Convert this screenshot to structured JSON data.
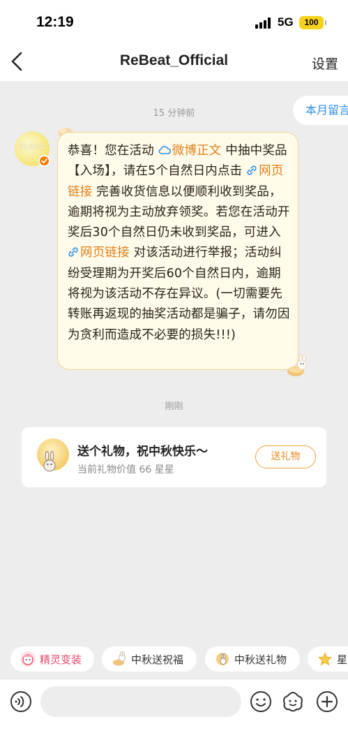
{
  "status": {
    "time": "12:19",
    "network": "5G",
    "battery": "100"
  },
  "nav": {
    "title": "ReBeat_Official",
    "settings": "设置"
  },
  "side_pill": {
    "label": "本月留言"
  },
  "avatar": {
    "text": "ReBeat"
  },
  "messages": [
    {
      "time": "15 分钟前",
      "segments": [
        {
          "text": "恭喜！您在活动 ",
          "link": false
        },
        {
          "text": "微博正文",
          "link": true,
          "icon": "cloud-icon"
        },
        {
          "text": " 中抽中奖品【入场】，请在5个自然日内点击 ",
          "link": false
        },
        {
          "text": "网页链接",
          "link": true,
          "icon": "link-icon"
        },
        {
          "text": " 完善收货信息以便顺利收到奖品，逾期将视为主动放弃领奖。若您在活动开奖后30个自然日仍未收到奖品，可进入 ",
          "link": false
        },
        {
          "text": "网页链接",
          "link": true,
          "icon": "link-icon"
        },
        {
          "text": " 对该活动进行举报；活动纠纷受理期为开奖后60个自然日内，逾期将视为该活动不存在异议。(一切需要先转账再返现的抽奖活动都是骗子，请勿因为贪利而造成不必要的损失!!!)",
          "link": false
        }
      ]
    }
  ],
  "gift": {
    "time": "刚刚",
    "title": "送个礼物，祝中秋快乐～",
    "subtitle": "当前礼物价值 66 星星",
    "button": "送礼物"
  },
  "quick_actions": [
    {
      "label": "精灵变装",
      "icon": "elf-icon",
      "color": "#e94a6a"
    },
    {
      "label": "中秋送祝福",
      "icon": "mooncake-rabbit-icon",
      "color": "#333333"
    },
    {
      "label": "中秋送礼物",
      "icon": "moon-rabbit-icon",
      "color": "#333333"
    },
    {
      "label": "星星",
      "icon": "star-icon",
      "color": "#333333"
    }
  ],
  "input": {
    "placeholder": ""
  },
  "colors": {
    "link": "#e0801b",
    "accent": "#f0a13a",
    "pill_text": "#2e8ee9"
  }
}
